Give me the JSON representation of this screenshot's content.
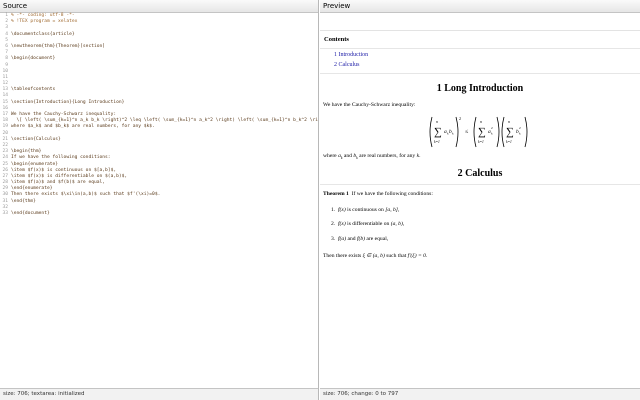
{
  "left_pane": {
    "title": "Source",
    "status": "size: 706; textarea: initialized",
    "lines": [
      {
        "n": "1",
        "text": "% -*- coding: utf-8 -*-",
        "comment": true
      },
      {
        "n": "2",
        "text": "% !TEX program = xelatex",
        "comment": true
      },
      {
        "n": "3",
        "text": ""
      },
      {
        "n": "4",
        "text": "\\documentclass{article}"
      },
      {
        "n": "5",
        "text": ""
      },
      {
        "n": "6",
        "text": "\\newtheorem{thm}{Theorem}[section]"
      },
      {
        "n": "7",
        "text": ""
      },
      {
        "n": "8",
        "text": "\\begin{document}"
      },
      {
        "n": "9",
        "text": ""
      },
      {
        "n": "10",
        "text": ""
      },
      {
        "n": "11",
        "text": ""
      },
      {
        "n": "12",
        "text": ""
      },
      {
        "n": "13",
        "text": "\\tableofcontents"
      },
      {
        "n": "14",
        "text": ""
      },
      {
        "n": "15",
        "text": "\\section{Introduction}{Long Introduction}"
      },
      {
        "n": "16",
        "text": ""
      },
      {
        "n": "17",
        "text": "We have the Cauchy-Schwarz inequality:"
      },
      {
        "n": "18",
        "text": "  \\[ \\left( \\sum_{k=1}^n a_k b_k \\right)^2 \\leq \\left( \\sum_{k=1}^n a_k^2 \\right) \\left( \\sum_{k=1}^n b_k^2 \\right) \\]"
      },
      {
        "n": "19",
        "text": "where $a_k$ and $b_k$ are real numbers, for any $k$."
      },
      {
        "n": "20",
        "text": ""
      },
      {
        "n": "21",
        "text": "\\section{Calculus}"
      },
      {
        "n": "22",
        "text": ""
      },
      {
        "n": "23",
        "text": "\\begin{thm}"
      },
      {
        "n": "24",
        "text": "If we have the following conditions:"
      },
      {
        "n": "25",
        "text": "\\begin{enumerate}"
      },
      {
        "n": "26",
        "text": "\\item $f(x)$ is continuous on $[a,b]$,"
      },
      {
        "n": "27",
        "text": "\\item $f(x)$ is differentiable on $(a,b)$,"
      },
      {
        "n": "28",
        "text": "\\item $f(a)$ and $f(b)$ are equal,"
      },
      {
        "n": "29",
        "text": "\\end{enumerate}"
      },
      {
        "n": "30",
        "text": "Then there exists $\\xi\\in(a,b)$ such that $f'(\\xi)=0$."
      },
      {
        "n": "31",
        "text": "\\end{thm}"
      },
      {
        "n": "32",
        "text": ""
      },
      {
        "n": "33",
        "text": "\\end{document}"
      }
    ]
  },
  "right_pane": {
    "title": "Preview",
    "status": "size: 706; change: 0 to 797",
    "contents_heading": "Contents",
    "toc": [
      "1 Introduction",
      "2 Calculus"
    ],
    "section1_title": "1  Long Introduction",
    "intro_text": "We have the Cauchy-Schwarz inequality:",
    "where_prefix": "where ",
    "where_a": "a",
    "where_a_sub": "k",
    "where_and": " and ",
    "where_b": "b",
    "where_b_sub": "k",
    "where_suffix": " are real numbers, for any ",
    "where_k": "k",
    "where_end": ".",
    "section2_title": "2  Calculus",
    "theorem_label": "Theorem 1",
    "theorem_intro": "If we have the following conditions:",
    "items": [
      {
        "num": "1.",
        "math": "f(x)",
        "text": " is continuous on ",
        "math2": "[a, b]",
        "end": ","
      },
      {
        "num": "2.",
        "math": "f(x)",
        "text": " is differentiable on ",
        "math2": "(a, b)",
        "end": ","
      },
      {
        "num": "3.",
        "math": "f(a)",
        "text": " and ",
        "math2": "f(b)",
        "end": " are equal,"
      }
    ],
    "conclusion_pre": "Then there exists ",
    "conclusion_math": "ξ ∈ (a, b)",
    "conclusion_mid": " such that ",
    "conclusion_math2": "f′(ξ) = 0",
    "conclusion_end": "."
  }
}
